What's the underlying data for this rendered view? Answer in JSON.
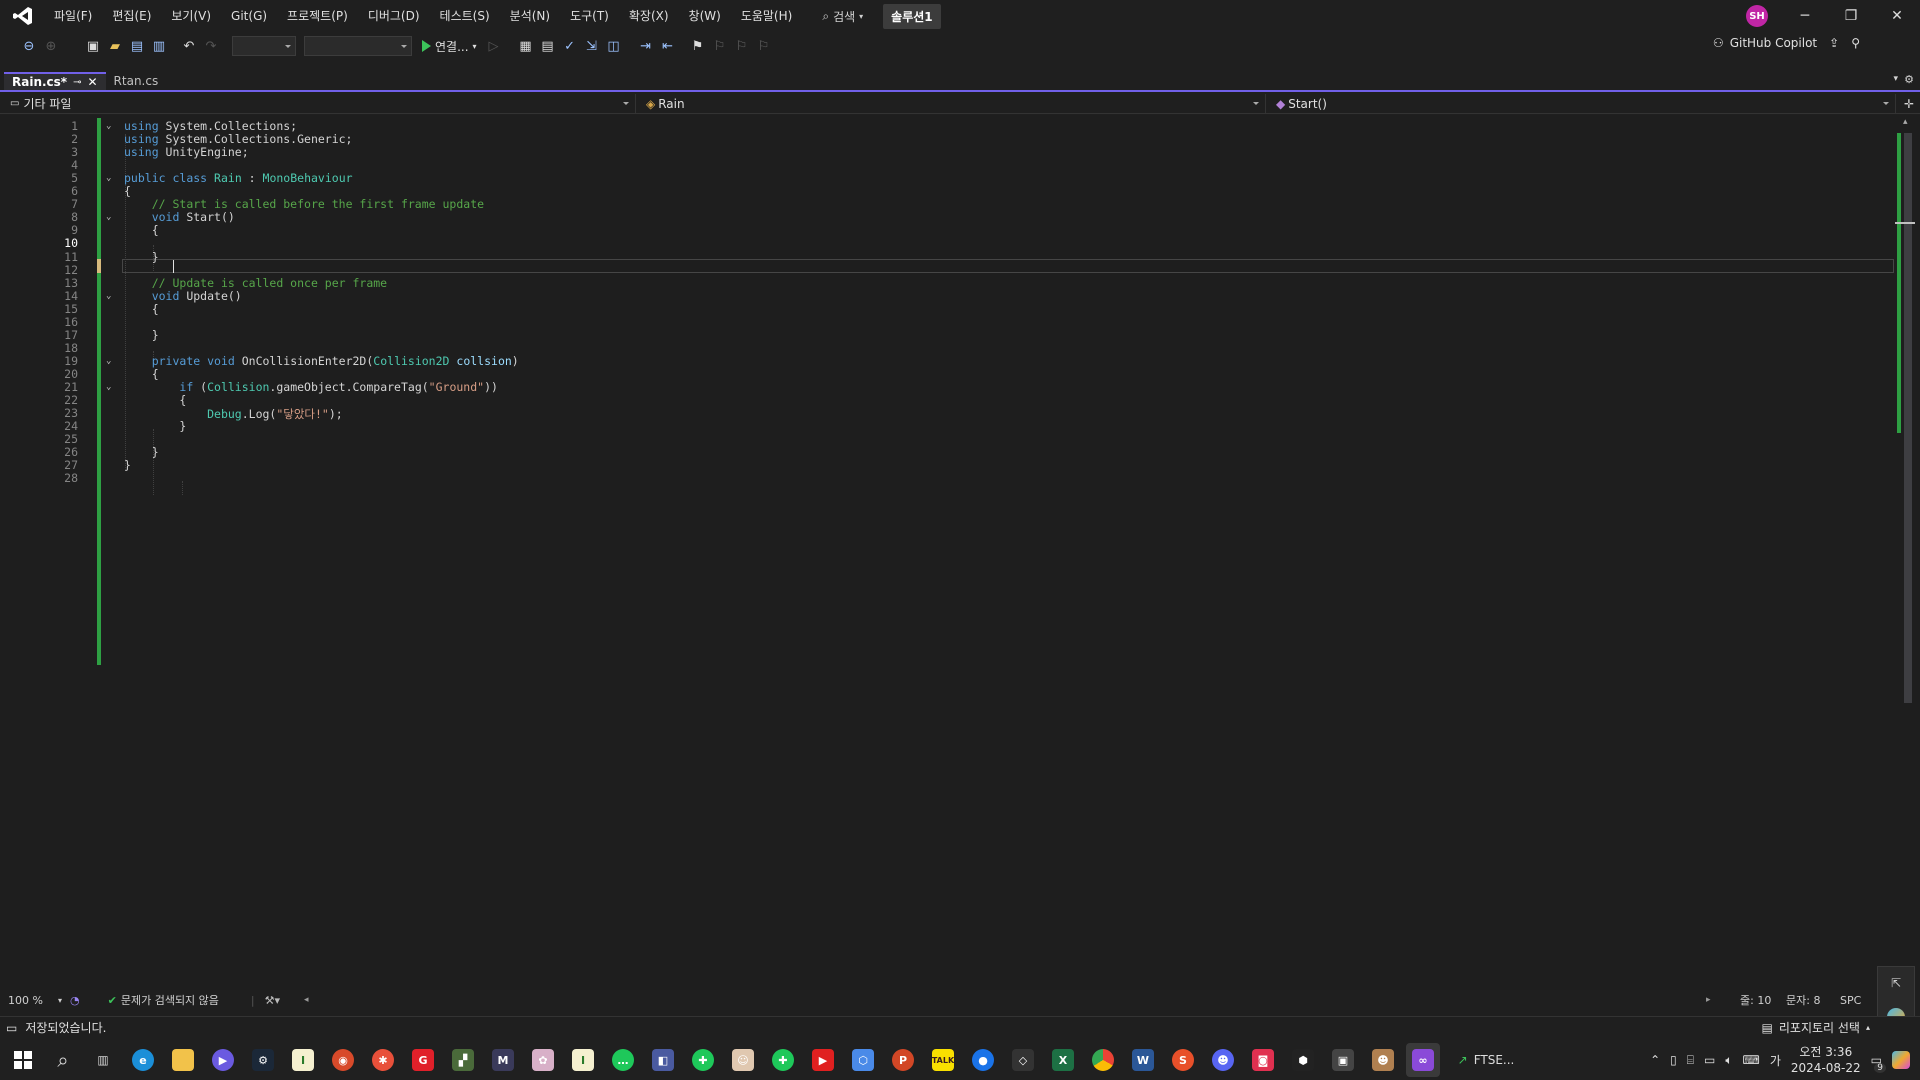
{
  "menu": {
    "items": [
      "파일(F)",
      "편집(E)",
      "보기(V)",
      "Git(G)",
      "프로젝트(P)",
      "디버그(D)",
      "테스트(S)",
      "분석(N)",
      "도구(T)",
      "확장(X)",
      "창(W)",
      "도움말(H)"
    ],
    "search_label": "검색",
    "solution": "솔루션1",
    "avatar": "SH"
  },
  "toolbar": {
    "run_label": "연결...",
    "copilot": "GitHub Copilot"
  },
  "tabs": [
    {
      "label": "Rain.cs*",
      "active": true
    },
    {
      "label": "Rtan.cs",
      "active": false
    }
  ],
  "nav": {
    "project": "기타 파일",
    "class": "Rain",
    "member": "Start()"
  },
  "code": {
    "current_line": 10,
    "lines": [
      "using System.Collections;",
      "using System.Collections.Generic;",
      "using UnityEngine;",
      "",
      "public class Rain : MonoBehaviour",
      "{",
      "    // Start is called before the first frame update",
      "    void Start()",
      "    {",
      "        ",
      "    }",
      "",
      "    // Update is called once per frame",
      "    void Update()",
      "    {",
      "",
      "    }",
      "",
      "    private void OnCollisionEnter2D(Collision2D collsion)",
      "    {",
      "        if (Collision.gameObject.CompareTag(\"Ground\"))",
      "        {",
      "            Debug.Log(\"닿았다!\");",
      "        }",
      "",
      "    }",
      "}",
      ""
    ]
  },
  "editor_status": {
    "zoom": "100 %",
    "issues": "문제가 검색되지 않음",
    "line": "줄: 10",
    "col": "문자: 8",
    "spc": "SPC"
  },
  "statusbar": {
    "saved": "저장되었습니다.",
    "repo": "리포지토리 선택"
  },
  "taskbar": {
    "ftse_label": "FTSE...",
    "time_ampm": "오전 3:36",
    "date": "2024-08-22",
    "ime": "가",
    "notif_count": "9"
  }
}
